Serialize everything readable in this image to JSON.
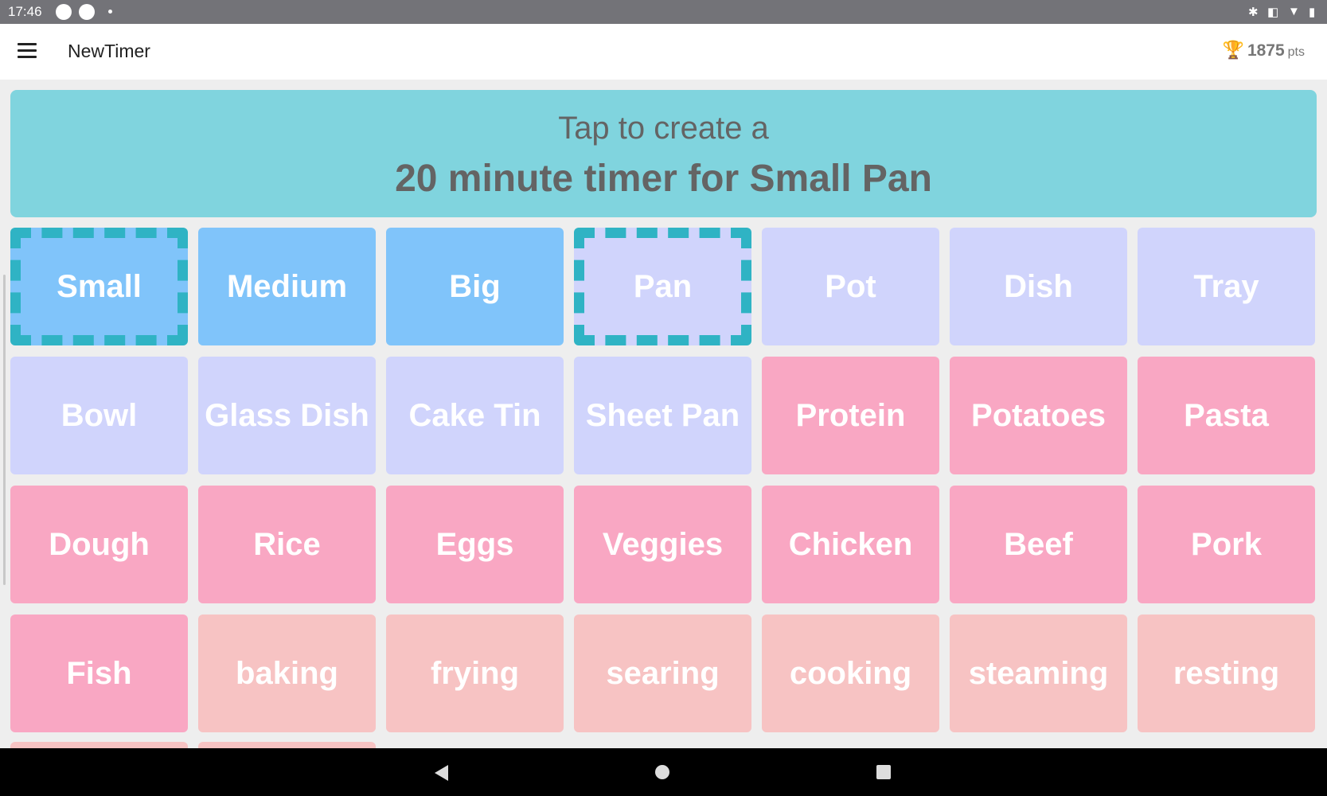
{
  "status_bar": {
    "time": "17:46"
  },
  "app_bar": {
    "title": "NewTimer",
    "points_value": "1875",
    "points_unit": "pts"
  },
  "banner": {
    "line1": "Tap to create a",
    "line2": "20 minute timer for Small Pan"
  },
  "tiles": [
    {
      "label": "Small",
      "color": "blue",
      "selected": true
    },
    {
      "label": "Medium",
      "color": "blue"
    },
    {
      "label": "Big",
      "color": "blue"
    },
    {
      "label": "Pan",
      "color": "lavender",
      "selected": true
    },
    {
      "label": "Pot",
      "color": "lavender"
    },
    {
      "label": "Dish",
      "color": "lavender"
    },
    {
      "label": "Tray",
      "color": "lavender"
    },
    {
      "label": "Bowl",
      "color": "lavender"
    },
    {
      "label": "Glass Dish",
      "color": "lavender"
    },
    {
      "label": "Cake Tin",
      "color": "lavender"
    },
    {
      "label": "Sheet Pan",
      "color": "lavender"
    },
    {
      "label": "Protein",
      "color": "pink"
    },
    {
      "label": "Potatoes",
      "color": "pink"
    },
    {
      "label": "Pasta",
      "color": "pink"
    },
    {
      "label": "Dough",
      "color": "pink"
    },
    {
      "label": "Rice",
      "color": "pink"
    },
    {
      "label": "Eggs",
      "color": "pink"
    },
    {
      "label": "Veggies",
      "color": "pink"
    },
    {
      "label": "Chicken",
      "color": "pink"
    },
    {
      "label": "Beef",
      "color": "pink"
    },
    {
      "label": "Pork",
      "color": "pink"
    },
    {
      "label": "Fish",
      "color": "pink"
    },
    {
      "label": "baking",
      "color": "peach"
    },
    {
      "label": "frying",
      "color": "peach"
    },
    {
      "label": "searing",
      "color": "peach"
    },
    {
      "label": "cooking",
      "color": "peach"
    },
    {
      "label": "steaming",
      "color": "peach"
    },
    {
      "label": "resting",
      "color": "peach"
    }
  ],
  "colors": {
    "blue": "#80c4fa",
    "lavender": "#d0d4fc",
    "pink": "#f9a7c3",
    "peach": "#f7c3c3",
    "banner": "#80d4de",
    "selection": "#2fb3c4"
  },
  "icons": {
    "menu": "hamburger-menu-icon",
    "points": "trophy-icon",
    "nav_back": "triangle-back-icon",
    "nav_home": "circle-home-icon",
    "nav_recent": "square-recents-icon"
  }
}
